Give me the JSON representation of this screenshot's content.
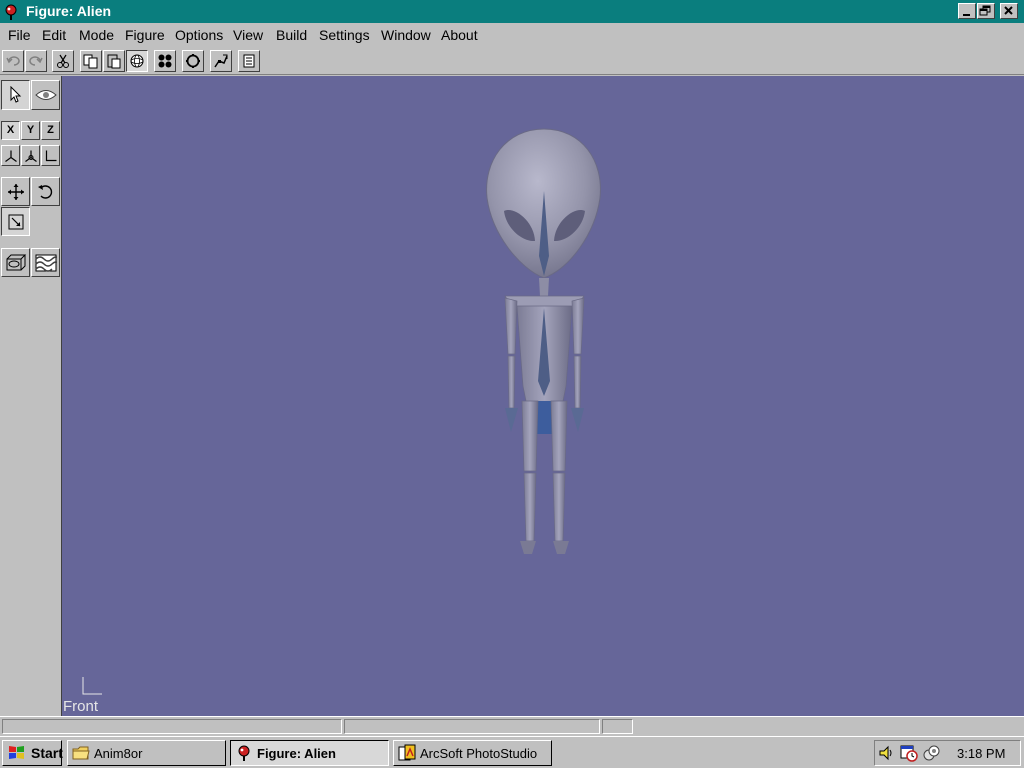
{
  "window": {
    "title": "Figure: Alien"
  },
  "menu": [
    "File",
    "Edit",
    "Mode",
    "Figure",
    "Options",
    "View",
    "Build",
    "Settings",
    "Window",
    "About"
  ],
  "left_tools": {
    "axis_x": "X",
    "axis_y": "Y",
    "axis_z": "Z"
  },
  "viewport": {
    "view_label": "Front",
    "background_color": "#666699"
  },
  "taskbar": {
    "start_label": "Start",
    "tasks": [
      "Anim8or",
      "Figure: Alien",
      "ArcSoft PhotoStudio"
    ],
    "clock": "3:18 PM"
  },
  "colors": {
    "title_bar": "#0a7e7e",
    "chrome": "#c0c0c0"
  },
  "icons": {
    "toolbar": [
      "undo-icon",
      "redo-icon",
      "cut-icon",
      "copy-icon",
      "paste-icon",
      "sphere-icon",
      "four-dots-icon",
      "circle-icon",
      "point-edit-icon",
      "list-icon"
    ]
  }
}
